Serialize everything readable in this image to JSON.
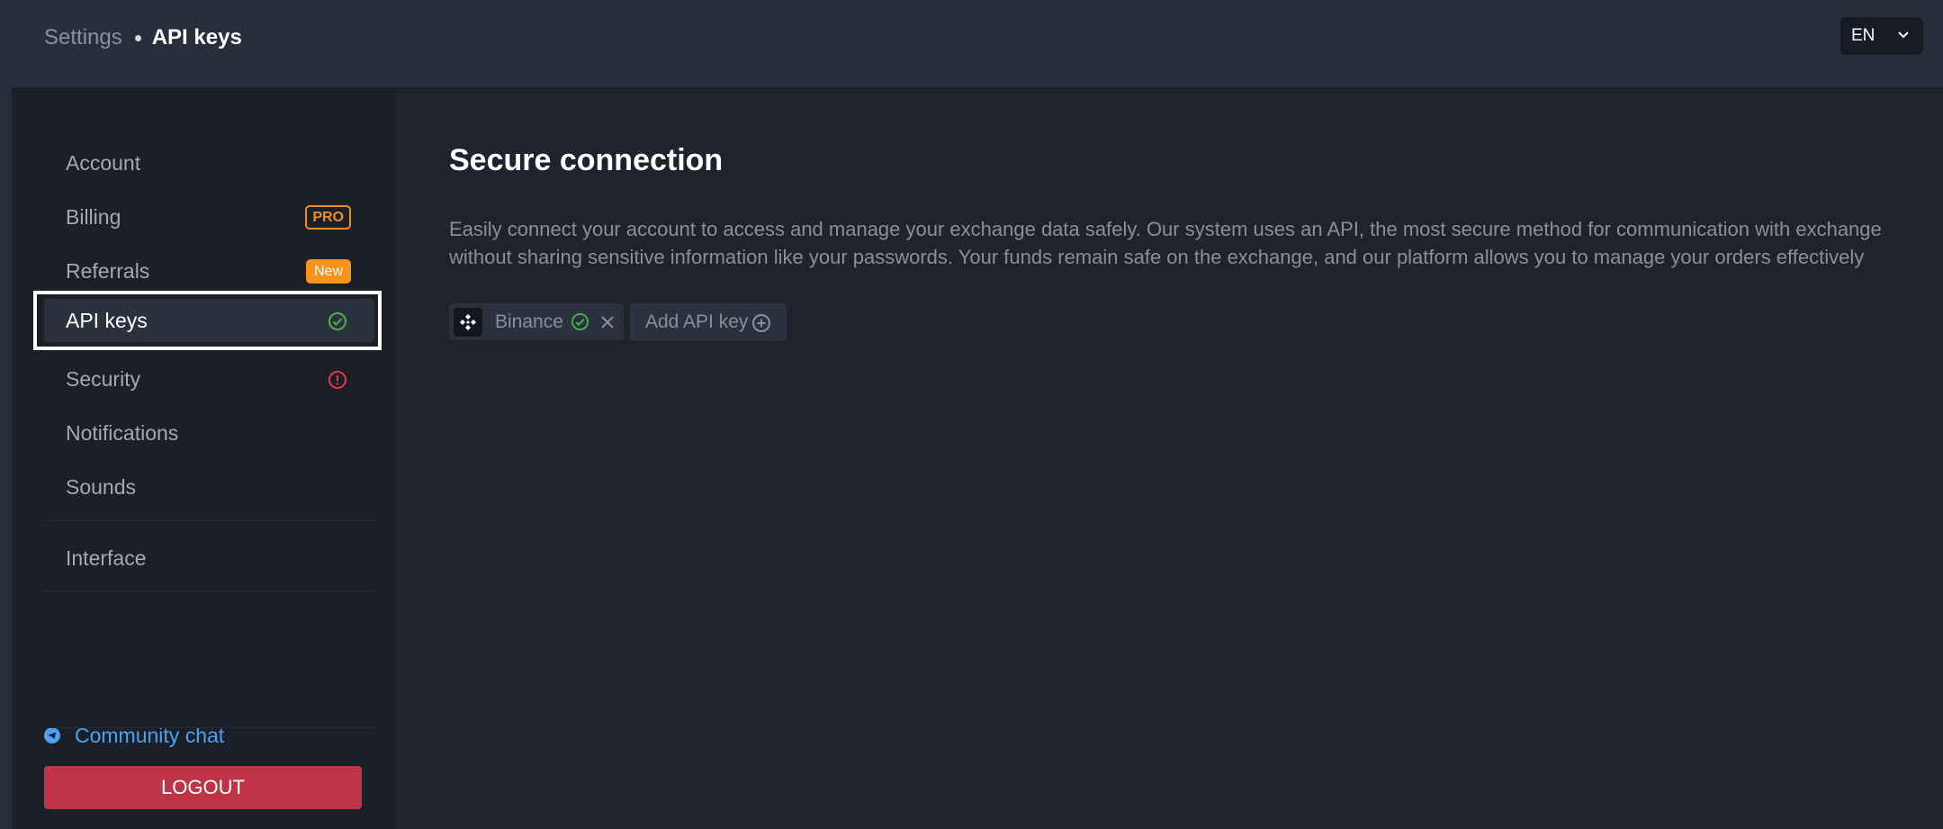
{
  "breadcrumb": {
    "root": "Settings",
    "current": "API keys"
  },
  "language": {
    "selected": "EN"
  },
  "sidebar": {
    "items": [
      {
        "label": "Account"
      },
      {
        "label": "Billing",
        "badge": "PRO"
      },
      {
        "label": "Referrals",
        "badge": "New"
      },
      {
        "label": "API keys",
        "status_icon": "check-circle-icon",
        "active": true
      },
      {
        "label": "Security",
        "status_icon": "alert-circle-icon"
      },
      {
        "label": "Notifications"
      },
      {
        "label": "Sounds"
      },
      {
        "label": "Interface"
      }
    ],
    "community_label": "Community chat",
    "logout_label": "LOGOUT"
  },
  "main": {
    "title": "Secure connection",
    "description": "Easily connect your account to access and manage your exchange data safely. Our system uses an API, the most secure method for communication with exchange without sharing sensitive information like your passwords. Your funds remain safe on the exchange, and our platform allows you to manage your orders effectively",
    "connections": [
      {
        "exchange": "Binance",
        "status_icon": "check-circle-icon"
      }
    ],
    "add_label": "Add API key"
  },
  "colors": {
    "accent_orange": "#f7931a",
    "success_green": "#4caf50",
    "error_red": "#e0364a",
    "link_blue": "#4aa3f0",
    "logout_red": "#bf3346"
  }
}
